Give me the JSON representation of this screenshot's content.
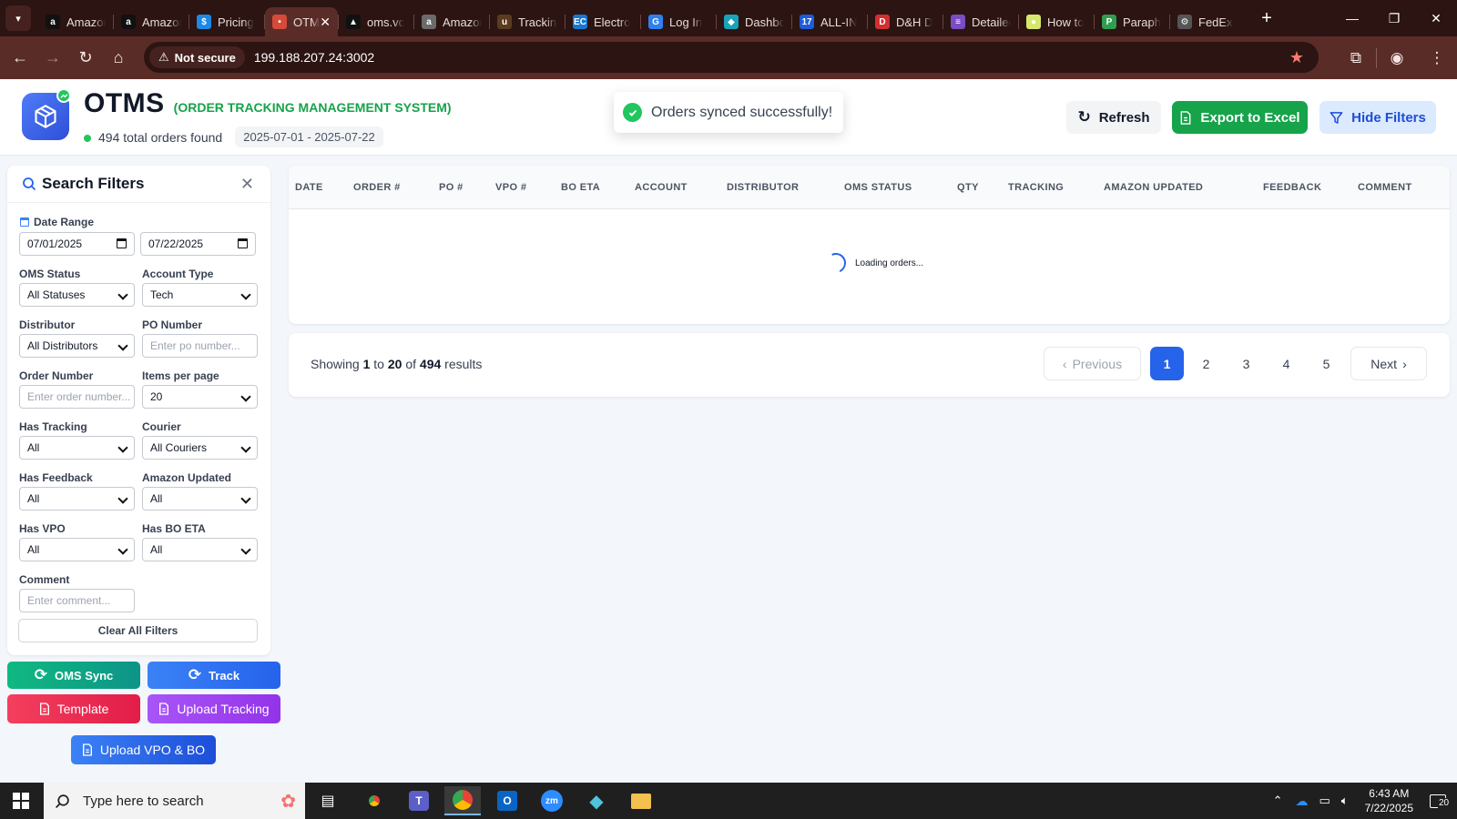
{
  "browser": {
    "tabs": [
      {
        "title": "Amazon",
        "icon": "amazon-icon",
        "color": "#111111",
        "glyph": "a"
      },
      {
        "title": "Amazon",
        "icon": "amazon-icon",
        "color": "#111111",
        "glyph": "a"
      },
      {
        "title": "Pricing",
        "icon": "dollar-icon",
        "color": "#1e88e5",
        "glyph": "$"
      },
      {
        "title": "OTMS",
        "icon": "otms-icon",
        "color": "#d64a3a",
        "glyph": "•",
        "active": true
      },
      {
        "title": "oms.vc",
        "icon": "triangle-icon",
        "color": "#111111",
        "glyph": "▲"
      },
      {
        "title": "Amazon",
        "icon": "amazon-icon",
        "color": "#6b6b6b",
        "glyph": "a"
      },
      {
        "title": "Tracking",
        "icon": "ups-icon",
        "color": "#5b3b1e",
        "glyph": "u"
      },
      {
        "title": "Electro",
        "icon": "ec-icon",
        "color": "#1976d2",
        "glyph": "EC"
      },
      {
        "title": "Log In",
        "icon": "login-icon",
        "color": "#2f80ed",
        "glyph": "G"
      },
      {
        "title": "Dashboard",
        "icon": "dashboard-icon",
        "color": "#1aa3b8",
        "glyph": "◆"
      },
      {
        "title": "ALL-IN",
        "icon": "seventeen-icon",
        "color": "#1e5bd8",
        "glyph": "17"
      },
      {
        "title": "D&H D",
        "icon": "dh-icon",
        "color": "#d32f2f",
        "glyph": "D"
      },
      {
        "title": "Detailed",
        "icon": "detail-icon",
        "color": "#7b4cc2",
        "glyph": "≡"
      },
      {
        "title": "How to",
        "icon": "howto-icon",
        "color": "#d6e86b",
        "glyph": "●"
      },
      {
        "title": "Paraph",
        "icon": "paraphrase-icon",
        "color": "#2e9e4f",
        "glyph": "P"
      },
      {
        "title": "FedEx",
        "icon": "fedex-icon",
        "color": "#555555",
        "glyph": "⚙"
      }
    ],
    "not_secure": "Not secure",
    "url": "199.188.207.24:3002"
  },
  "header": {
    "brand": "OTMS",
    "subtitle": "(ORDER TRACKING MANAGEMENT SYSTEM)",
    "total_orders": "494 total orders found",
    "date_range": "2025-07-01 - 2025-07-22",
    "toast": "Orders synced successfully!",
    "refresh": "Refresh",
    "export": "Export to Excel",
    "hide_filters": "Hide Filters"
  },
  "filters": {
    "title": "Search Filters",
    "date_range_label": "Date Range",
    "date_from": "07/01/2025",
    "date_to": "07/22/2025",
    "oms_status_label": "OMS Status",
    "oms_status": "All Statuses",
    "account_type_label": "Account Type",
    "account_type": "Tech",
    "distributor_label": "Distributor",
    "distributor": "All Distributors",
    "po_number_label": "PO Number",
    "po_number_placeholder": "Enter po number...",
    "order_number_label": "Order Number",
    "order_number_placeholder": "Enter order number...",
    "items_per_page_label": "Items per page",
    "items_per_page": "20",
    "has_tracking_label": "Has Tracking",
    "has_tracking": "All",
    "courier_label": "Courier",
    "courier": "All Couriers",
    "has_feedback_label": "Has Feedback",
    "has_feedback": "All",
    "amazon_updated_label": "Amazon Updated",
    "amazon_updated": "All",
    "has_vpo_label": "Has VPO",
    "has_vpo": "All",
    "has_bo_eta_label": "Has BO ETA",
    "has_bo_eta": "All",
    "comment_label": "Comment",
    "comment_placeholder": "Enter comment...",
    "clear_all": "Clear All Filters"
  },
  "actions": {
    "oms_sync": "OMS Sync",
    "track": "Track",
    "template": "Template",
    "upload_tracking": "Upload Tracking",
    "upload_vpo_bo": "Upload VPO & BO"
  },
  "table": {
    "columns": [
      "DATE",
      "ORDER #",
      "PO #",
      "VPO #",
      "BO ETA",
      "ACCOUNT",
      "DISTRIBUTOR",
      "OMS STATUS",
      "QTY",
      "TRACKING",
      "AMAZON UPDATED",
      "FEEDBACK",
      "COMMENT"
    ],
    "loading": "Loading orders..."
  },
  "pagination": {
    "showing_prefix": "Showing",
    "from": "1",
    "to_word": "to",
    "to": "20",
    "of_word": "of",
    "total": "494",
    "results_word": "results",
    "previous": "Previous",
    "next": "Next",
    "pages": [
      "1",
      "2",
      "3",
      "4",
      "5"
    ],
    "current": "1"
  },
  "taskbar": {
    "search_placeholder": "Type here to search",
    "time": "6:43 AM",
    "date": "7/22/2025",
    "notifications": "20"
  }
}
